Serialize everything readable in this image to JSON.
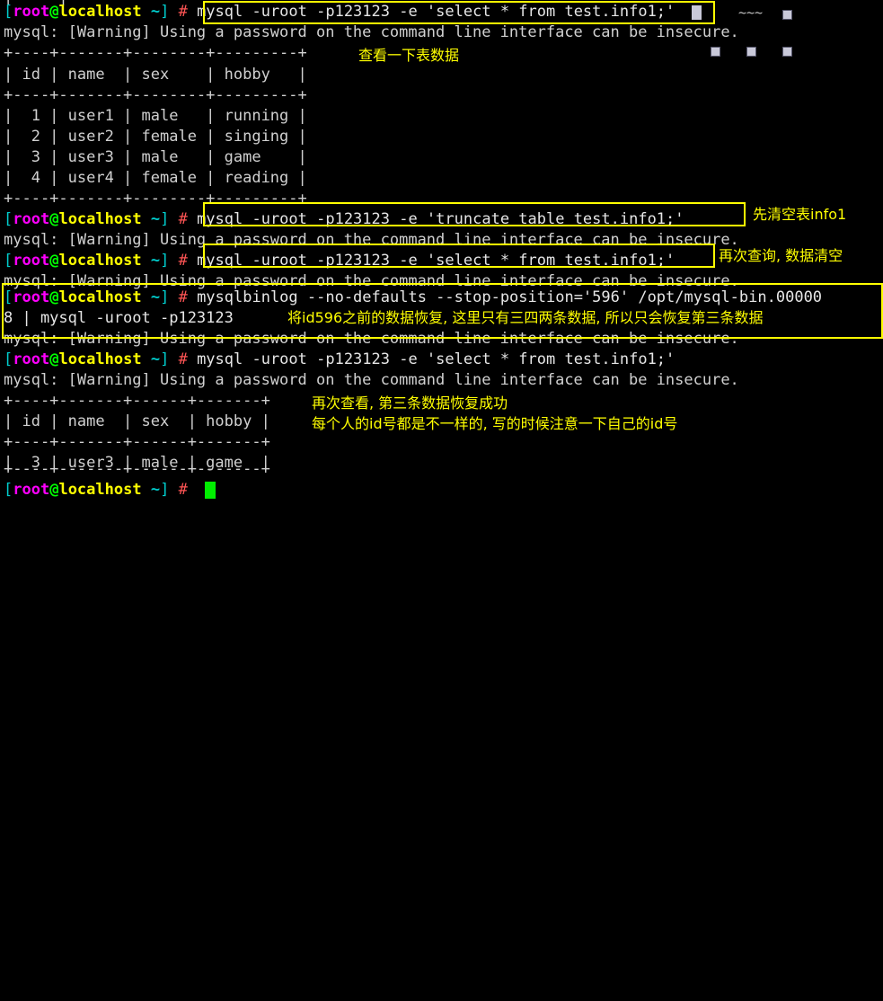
{
  "terminal": {
    "prompt": {
      "open_bracket": "[",
      "user": "root",
      "at": "@",
      "host": "localhost",
      "path": " ~",
      "close_bracket": "]",
      "sigil": "#"
    },
    "warning_line": "mysql: [Warning] Using a password on the command line interface can be insecure.",
    "commands": {
      "select1": "mysql -uroot -p123123 -e 'select * from test.info1;'",
      "truncate": "mysql -uroot -p123123 -e 'truncate table test.info1;'",
      "select2": "mysql -uroot -p123123 -e 'select * from test.info1;'",
      "binlog_line1": "mysqlbinlog --no-defaults --stop-position='596' /opt/mysql-bin.00000",
      "binlog_line2": "8 | mysql -uroot -p123123",
      "select3": "mysql -uroot -p123123 -e 'select * from test.info1;'"
    },
    "tables": {
      "separator": "+----+-------+--------+---------+",
      "header_row": "| id | name  | sex    | hobby   |",
      "full_rows": [
        "|  1 | user1 | male   | running |",
        "|  2 | user2 | female | singing |",
        "|  3 | user3 | male   | game    |",
        "|  4 | user4 | female | reading |"
      ],
      "restored_separator": "+----+-------+------+-------+",
      "restored_header": "| id | name  | sex  | hobby |",
      "restored_rows": [
        "|  3 | user3 | male | game  |"
      ]
    },
    "annotations": {
      "view_table_data": "查看一下表数据",
      "truncate_first": "先清空表info1",
      "query_again_empty": "再次查询, 数据清空",
      "restore_note": "将id596之前的数据恢复, 这里只有三四两条数据, 所以只会恢复第三条数据",
      "restore_success": "再次查看, 第三条数据恢复成功",
      "id_warning": "每个人的id号都是不一样的, 写的时候注意一下自己的id号"
    },
    "colors": {
      "background": "#000000",
      "foreground": "#d8d8d8",
      "highlight": "#ffff00",
      "user": "#ff00ff",
      "host": "#ffff00",
      "at": "#00ff00",
      "bracket": "#00cdcd",
      "hash": "#ff5555",
      "cursor": "#00ee00"
    },
    "top_stub": "|     |"
  }
}
